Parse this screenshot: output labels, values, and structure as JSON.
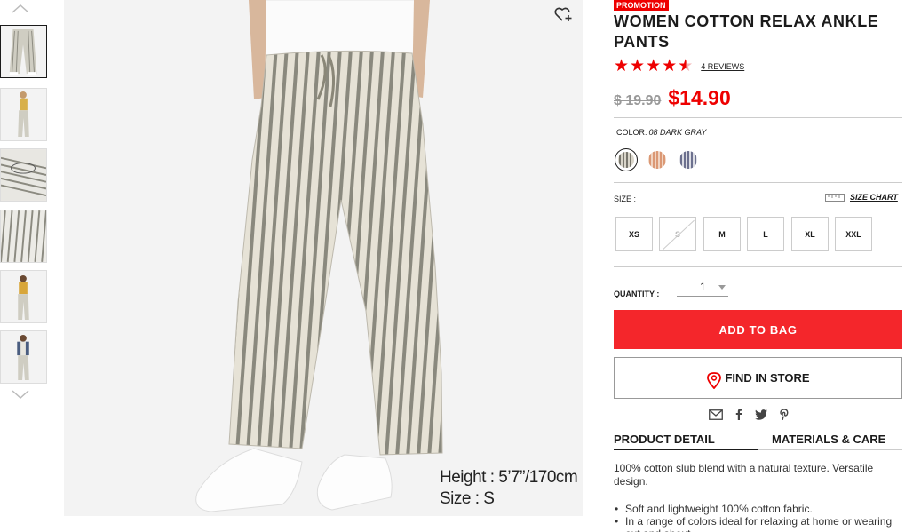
{
  "thumbnails": {
    "up_icon": "chevron-up-icon",
    "down_icon": "chevron-down-icon",
    "items": [
      "front-view",
      "model-full",
      "waist-detail",
      "fabric-detail",
      "model-mustard",
      "model-cardigan"
    ]
  },
  "main_image": {
    "height_label": "Height : 5’7”/170cm",
    "size_label": "Size : S",
    "favorite_icon": "heart-add-icon"
  },
  "product": {
    "badge": "PROMOTION",
    "title": "WOMEN COTTON RELAX ANKLE PANTS",
    "rating": 4.5,
    "reviews_label": "4 REVIEWS",
    "old_price": "$ 19.90",
    "price": "$14.90"
  },
  "color": {
    "label": "COLOR:",
    "value": "08 DARK GRAY",
    "swatches": [
      {
        "name": "dark-gray",
        "color": "#8d8a80",
        "selected": true
      },
      {
        "name": "orange",
        "color": "#d99a78",
        "selected": false
      },
      {
        "name": "navy",
        "color": "#6e7390",
        "selected": false
      }
    ]
  },
  "size": {
    "label": "SIZE :",
    "chart_label": "SIZE CHART",
    "options": [
      {
        "label": "XS",
        "available": true
      },
      {
        "label": "S",
        "available": false
      },
      {
        "label": "M",
        "available": true
      },
      {
        "label": "L",
        "available": true
      },
      {
        "label": "XL",
        "available": true
      },
      {
        "label": "XXL",
        "available": true
      }
    ]
  },
  "quantity": {
    "label": "QUANTITY :",
    "value": "1"
  },
  "actions": {
    "add_to_bag": "ADD TO BAG",
    "find_in_store": "FIND IN STORE"
  },
  "share_icons": [
    "mail-icon",
    "facebook-icon",
    "twitter-icon",
    "pinterest-icon"
  ],
  "tabs": {
    "detail": "PRODUCT DETAIL",
    "materials": "MATERIALS & CARE"
  },
  "detail": {
    "description": "100% cotton slub blend with a natural texture. Versatile design.",
    "bullets": [
      "Soft and lightweight 100% cotton fabric.",
      "In a range of colors ideal for relaxing at home or wearing out and about."
    ]
  },
  "colors": {
    "accent": "#f4262b",
    "stars": "#ee0000"
  }
}
